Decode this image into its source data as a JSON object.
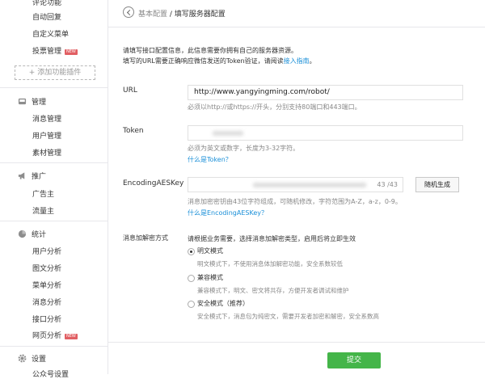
{
  "sidebar": {
    "top_cut": "评论功能",
    "func_items": [
      {
        "label": "自动回复"
      },
      {
        "label": "自定义菜单"
      },
      {
        "label": "投票管理",
        "badge": "NEW"
      }
    ],
    "add_plugin": "添加功能插件",
    "sections": [
      {
        "title": "管理",
        "icon": "inbox-icon",
        "items": [
          "消息管理",
          "用户管理",
          "素材管理"
        ]
      },
      {
        "title": "推广",
        "icon": "megaphone-icon",
        "items": [
          "广告主",
          "流量主"
        ]
      },
      {
        "title": "统计",
        "icon": "chart-icon",
        "items": [
          "用户分析",
          "图文分析",
          "菜单分析",
          "消息分析",
          "接口分析"
        ]
      }
    ],
    "web_analysis": {
      "label": "网页分析",
      "badge": "NEW"
    },
    "settings": {
      "title": "设置",
      "icon": "gear-icon"
    },
    "bottom_cut": "公众号设置",
    "badge_color": "#e15f63"
  },
  "breadcrumb": {
    "prev": "基本配置",
    "sep": " / ",
    "current": "填写服务器配置"
  },
  "intro": {
    "line1": "请填写接口配置信息，此信息需要你拥有自己的服务器资源。",
    "line2_prefix": "填写的URL需要正确响应微信发送的Token验证，请阅读",
    "line2_link": "接入指南",
    "line2_suffix": "。"
  },
  "form": {
    "url": {
      "label": "URL",
      "value": "http://www.yangyingming.com/robot/",
      "hint": "必须以http://或https://开头，分别支持80端口和443端口。"
    },
    "token": {
      "label": "Token",
      "value": "",
      "hint": "必须为英文或数字，长度为3-32字符。",
      "link": "什么是Token？"
    },
    "aes": {
      "label": "EncodingAESKey",
      "value": "",
      "counter": "43 /43",
      "button": "随机生成",
      "hint": "消息加密密钥由43位字符组成，可随机修改，字符范围为A-Z，a-z，0-9。",
      "link": "什么是EncodingAESKey？"
    },
    "encrypt": {
      "label": "消息加解密方式",
      "intro": "请根据业务需要，选择消息加解密类型，启用后将立即生效",
      "options": [
        {
          "label": "明文模式",
          "desc": "明文模式下，不使用消息体加解密功能，安全系数较低",
          "selected": true
        },
        {
          "label": "兼容模式",
          "desc": "兼容模式下，明文、密文将共存，方便开发者调试和维护",
          "selected": false
        },
        {
          "label": "安全模式（推荐）",
          "desc": "安全模式下，消息包为纯密文，需要开发者加密和解密，安全系数高",
          "selected": false
        }
      ]
    }
  },
  "submit": {
    "label": "提交",
    "color": "#44b549"
  },
  "link_color": "#1a8fd8"
}
